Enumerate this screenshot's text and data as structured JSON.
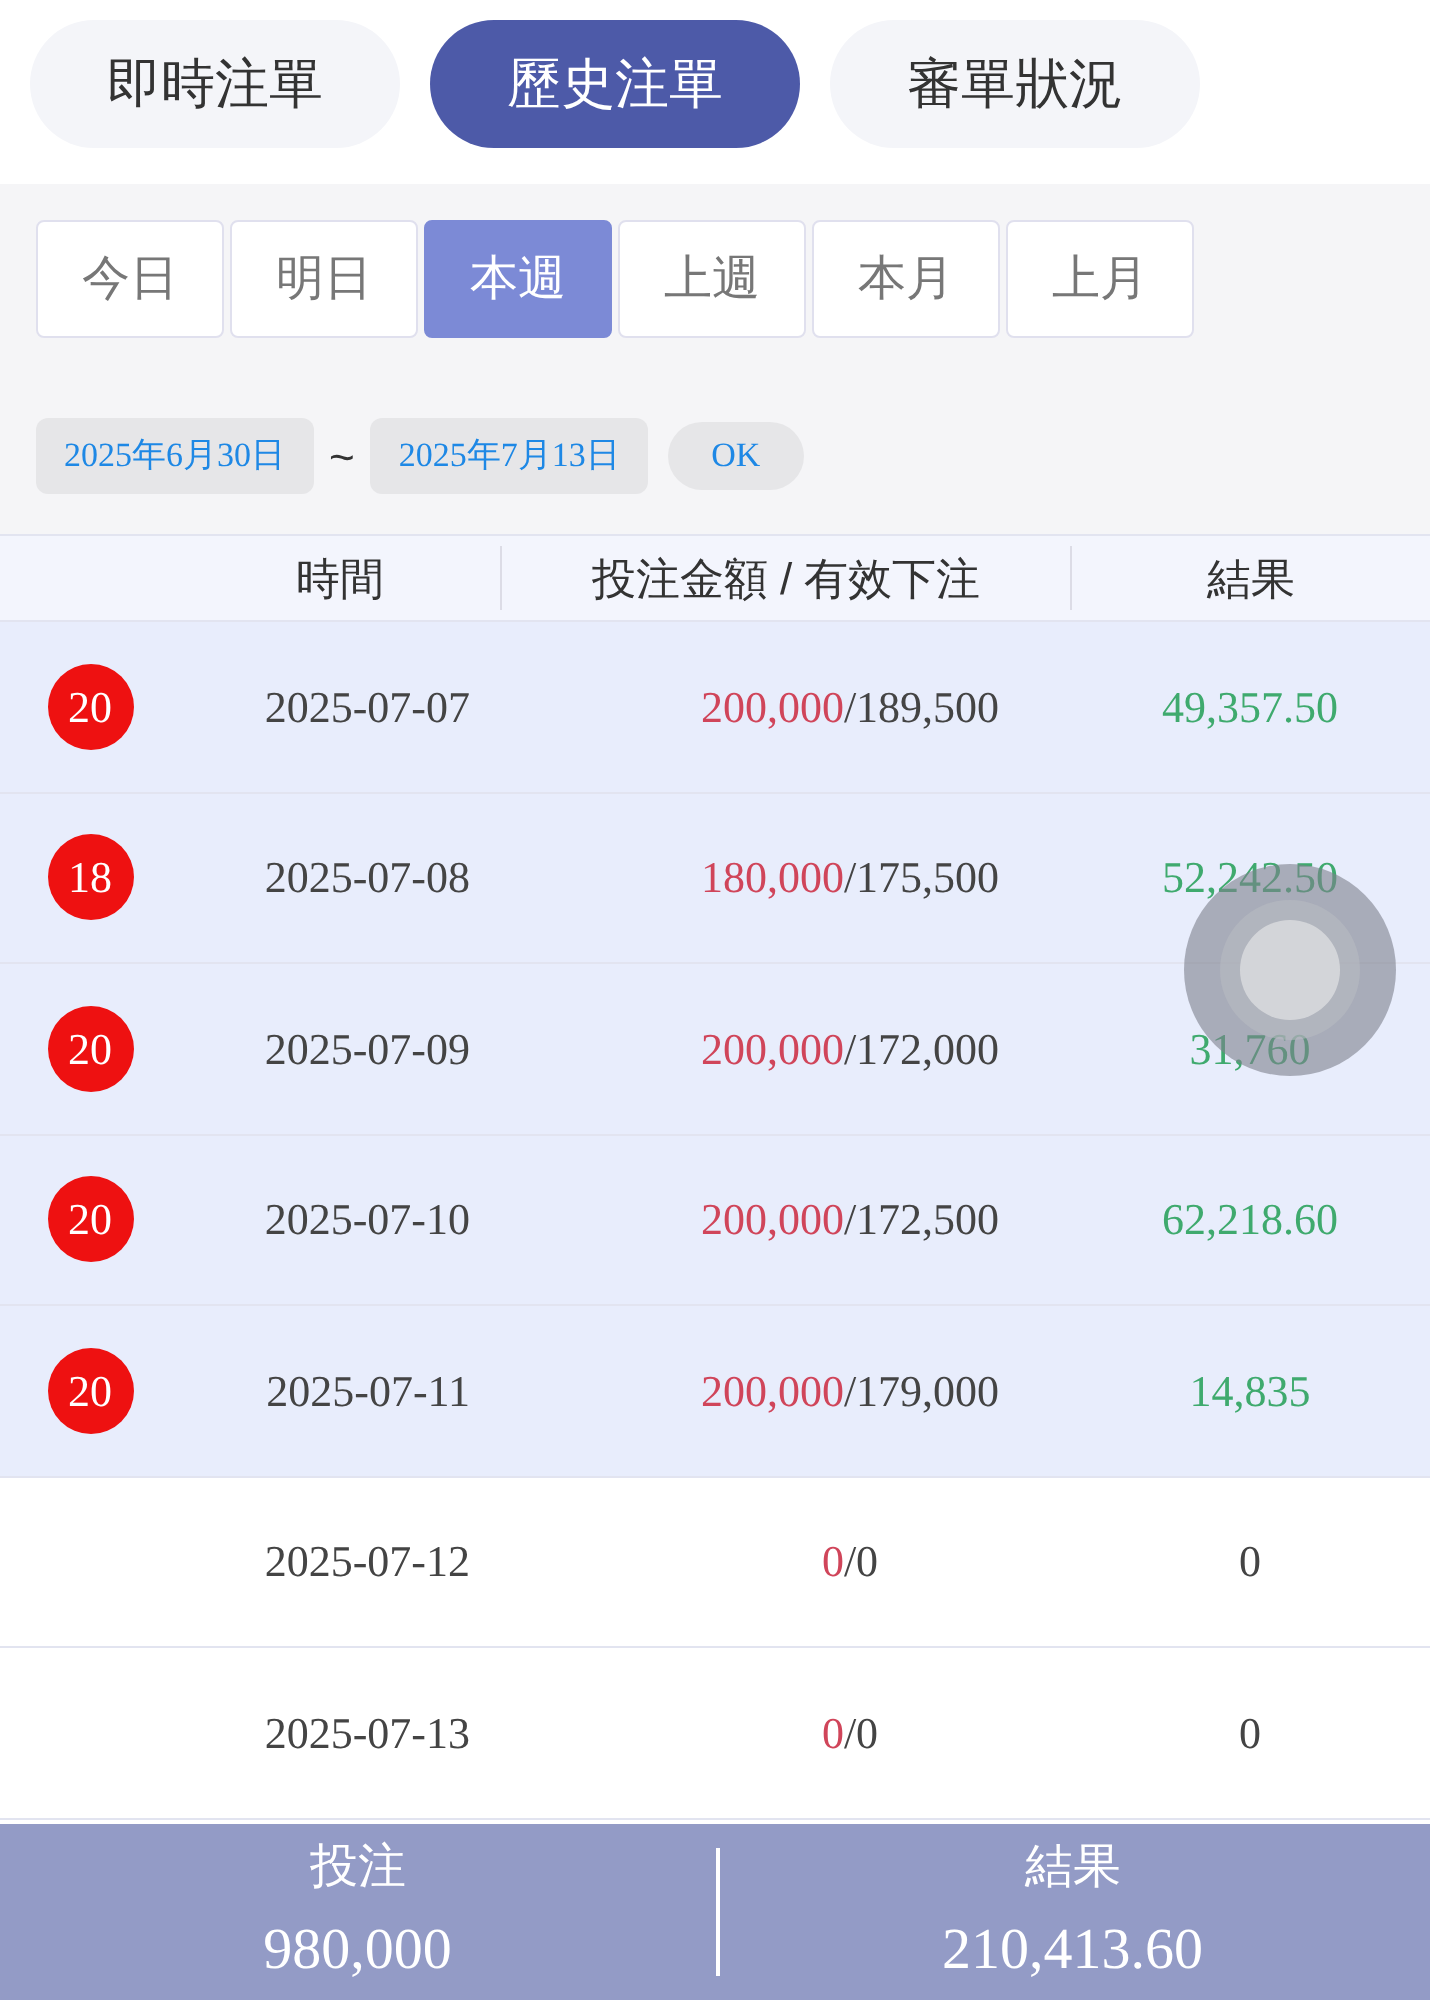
{
  "top_tabs": [
    {
      "label": "即時注單",
      "selected": false
    },
    {
      "label": "歷史注單",
      "selected": true
    },
    {
      "label": "審單狀況",
      "selected": false
    }
  ],
  "periods": [
    {
      "label": "今日",
      "selected": false
    },
    {
      "label": "明日",
      "selected": false
    },
    {
      "label": "本週",
      "selected": true
    },
    {
      "label": "上週",
      "selected": false
    },
    {
      "label": "本月",
      "selected": false
    },
    {
      "label": "上月",
      "selected": false
    }
  ],
  "date_range": {
    "start": "2025年6月30日",
    "separator": "~",
    "end": "2025年7月13日",
    "confirm": "OK"
  },
  "table": {
    "columns": [
      "時間",
      "投注金額 / 有效下注",
      "結果"
    ],
    "rows": [
      {
        "badge": "20",
        "date": "2025-07-07",
        "bet": "200,000",
        "valid": "/189,500",
        "result": "49,357.50",
        "highlighted": true
      },
      {
        "badge": "18",
        "date": "2025-07-08",
        "bet": "180,000",
        "valid": "/175,500",
        "result": "52,242.50",
        "highlighted": true
      },
      {
        "badge": "20",
        "date": "2025-07-09",
        "bet": "200,000",
        "valid": "/172,000",
        "result": "31,760",
        "highlighted": true
      },
      {
        "badge": "20",
        "date": "2025-07-10",
        "bet": "200,000",
        "valid": "/172,500",
        "result": "62,218.60",
        "highlighted": true
      },
      {
        "badge": "20",
        "date": "2025-07-11",
        "bet": "200,000",
        "valid": "/179,000",
        "result": "14,835",
        "highlighted": true
      },
      {
        "date": "2025-07-12",
        "bet": "0",
        "valid": "/0",
        "result": "0",
        "highlighted": false
      },
      {
        "date": "2025-07-13",
        "bet": "0",
        "valid": "/0",
        "result": "0",
        "highlighted": false
      }
    ]
  },
  "summary": [
    {
      "label": "投注",
      "value": "980,000"
    },
    {
      "label": "結果",
      "value": "210,413.60"
    }
  ]
}
